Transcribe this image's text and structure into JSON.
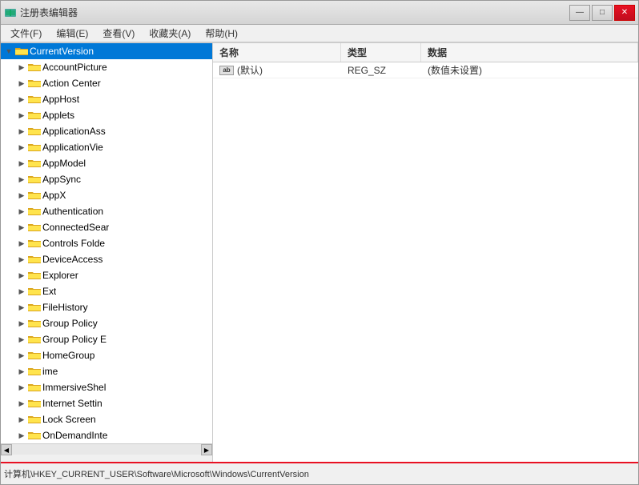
{
  "window": {
    "title": "注册表编辑器",
    "icon": "registry-icon"
  },
  "titlebar": {
    "title": "注册表编辑器",
    "minimize_label": "—",
    "maximize_label": "□",
    "close_label": "✕"
  },
  "menubar": {
    "items": [
      {
        "label": "文件(F)"
      },
      {
        "label": "编辑(E)"
      },
      {
        "label": "查看(V)"
      },
      {
        "label": "收藏夹(A)"
      },
      {
        "label": "帮助(H)"
      }
    ]
  },
  "tree": {
    "selected_item": "CurrentVersion",
    "items": [
      {
        "label": "CurrentVersion",
        "level": 0,
        "expanded": true,
        "selected": true
      },
      {
        "label": "AccountPicture",
        "level": 1,
        "expanded": false,
        "selected": false
      },
      {
        "label": "Action Center",
        "level": 1,
        "expanded": false,
        "selected": false
      },
      {
        "label": "AppHost",
        "level": 1,
        "expanded": false,
        "selected": false
      },
      {
        "label": "Applets",
        "level": 1,
        "expanded": false,
        "selected": false
      },
      {
        "label": "ApplicationAss",
        "level": 1,
        "expanded": false,
        "selected": false
      },
      {
        "label": "ApplicationVie",
        "level": 1,
        "expanded": false,
        "selected": false
      },
      {
        "label": "AppModel",
        "level": 1,
        "expanded": false,
        "selected": false
      },
      {
        "label": "AppSync",
        "level": 1,
        "expanded": false,
        "selected": false
      },
      {
        "label": "AppX",
        "level": 1,
        "expanded": false,
        "selected": false
      },
      {
        "label": "Authentication",
        "level": 1,
        "expanded": false,
        "selected": false
      },
      {
        "label": "ConnectedSear",
        "level": 1,
        "expanded": false,
        "selected": false
      },
      {
        "label": "Controls Folde",
        "level": 1,
        "expanded": false,
        "selected": false
      },
      {
        "label": "DeviceAccess",
        "level": 1,
        "expanded": false,
        "selected": false
      },
      {
        "label": "Explorer",
        "level": 1,
        "expanded": false,
        "selected": false
      },
      {
        "label": "Ext",
        "level": 1,
        "expanded": false,
        "selected": false
      },
      {
        "label": "FileHistory",
        "level": 1,
        "expanded": false,
        "selected": false
      },
      {
        "label": "Group Policy",
        "level": 1,
        "expanded": false,
        "selected": false
      },
      {
        "label": "Group Policy E",
        "level": 1,
        "expanded": false,
        "selected": false
      },
      {
        "label": "HomeGroup",
        "level": 1,
        "expanded": false,
        "selected": false
      },
      {
        "label": "ime",
        "level": 1,
        "expanded": false,
        "selected": false
      },
      {
        "label": "ImmersiveShel",
        "level": 1,
        "expanded": false,
        "selected": false
      },
      {
        "label": "Internet Settin",
        "level": 1,
        "expanded": false,
        "selected": false
      },
      {
        "label": "Lock Screen",
        "level": 1,
        "expanded": false,
        "selected": false
      },
      {
        "label": "OnDemandInte",
        "level": 1,
        "expanded": false,
        "selected": false
      }
    ]
  },
  "table": {
    "headers": {
      "name": "名称",
      "type": "类型",
      "data": "数据"
    },
    "rows": [
      {
        "name": "(默认)",
        "type": "REG_SZ",
        "data": "(数值未设置)",
        "icon": "ab"
      }
    ]
  },
  "statusbar": {
    "path": "计算机\\HKEY_CURRENT_USER\\Software\\Microsoft\\Windows\\CurrentVersion"
  }
}
